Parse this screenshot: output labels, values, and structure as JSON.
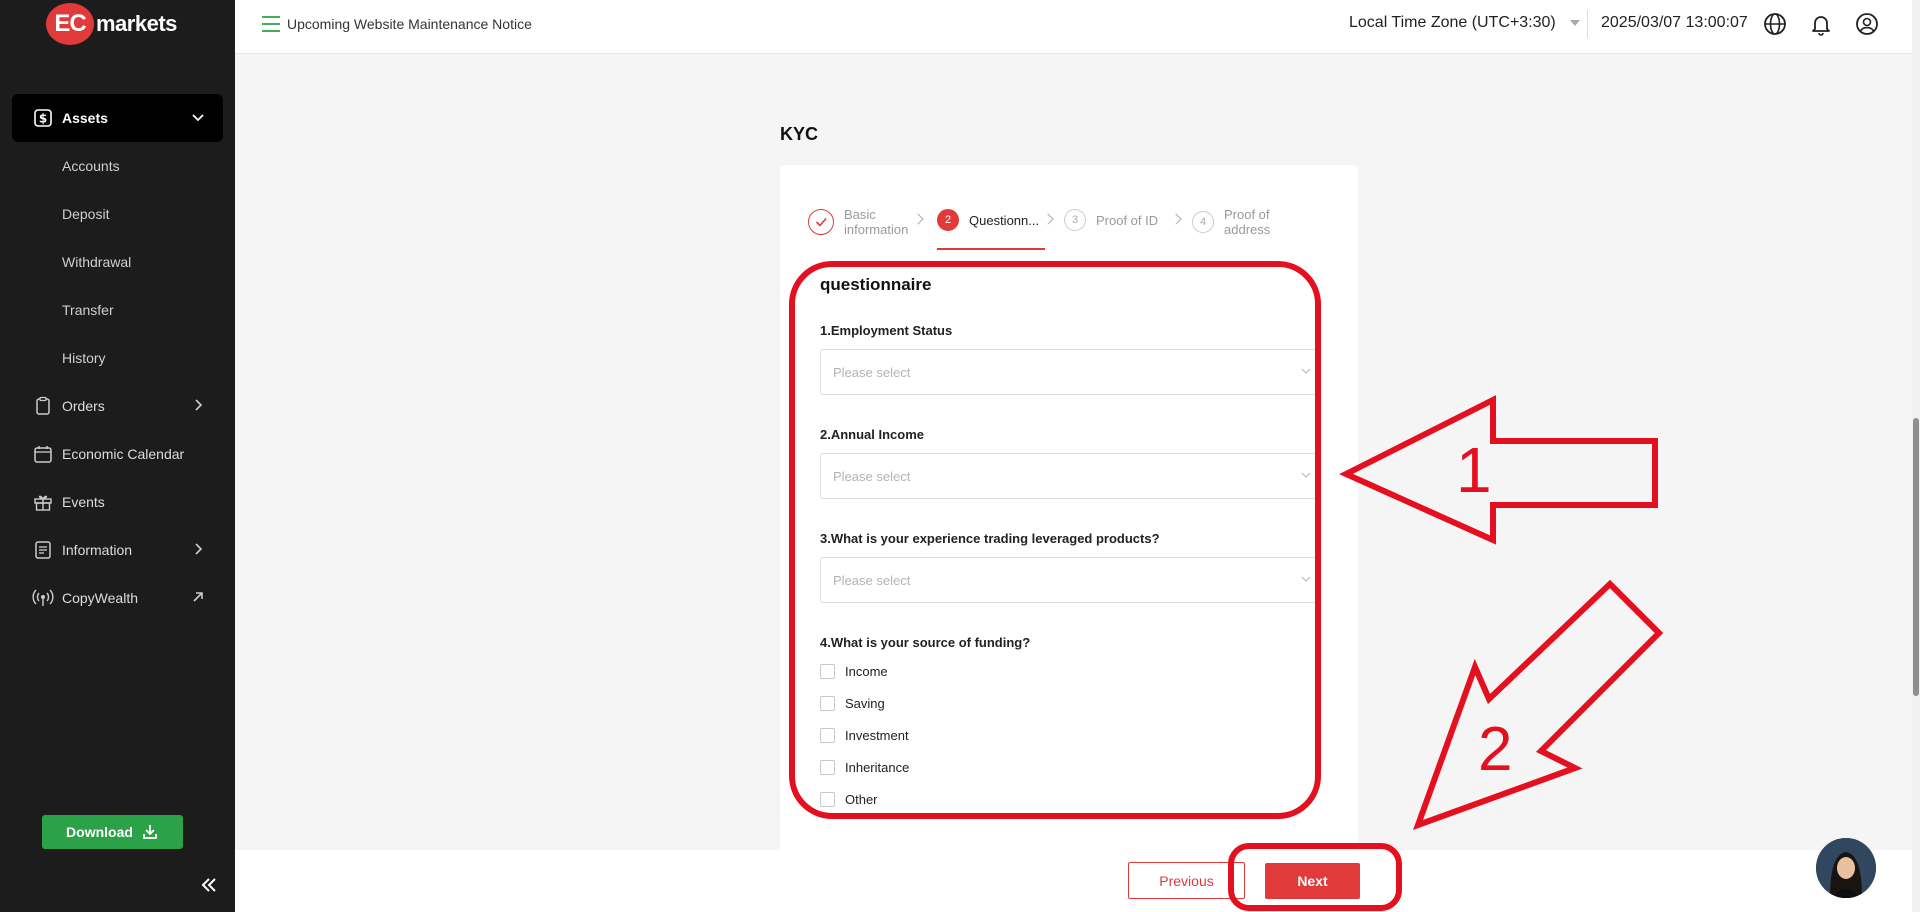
{
  "brand": {
    "badge": "EC",
    "name": "markets"
  },
  "sidebar": {
    "items": [
      {
        "label": "Assets",
        "icon": "dollar-square-icon"
      },
      {
        "label": "Accounts"
      },
      {
        "label": "Deposit"
      },
      {
        "label": "Withdrawal"
      },
      {
        "label": "Transfer"
      },
      {
        "label": "History"
      },
      {
        "label": "Orders",
        "icon": "clipboard-icon"
      },
      {
        "label": "Economic Calendar",
        "icon": "calendar-icon"
      },
      {
        "label": "Events",
        "icon": "gift-icon"
      },
      {
        "label": "Information",
        "icon": "document-icon"
      },
      {
        "label": "CopyWealth",
        "icon": "broadcast-icon"
      }
    ],
    "download_label": "Download"
  },
  "topbar": {
    "notice": "Upcoming Website Maintenance Notice",
    "timezone": "Local Time Zone (UTC+3:30)",
    "datetime": "2025/03/07 13:00:07"
  },
  "kyc": {
    "title": "KYC",
    "steps": [
      {
        "number": "",
        "label_line1": "Basic",
        "label_line2": "information",
        "state": "done"
      },
      {
        "number": "2",
        "label_line1": "Questionn...",
        "label_line2": "",
        "state": "current"
      },
      {
        "number": "3",
        "label_line1": "Proof of ID",
        "label_line2": "",
        "state": "pending"
      },
      {
        "number": "4",
        "label_line1": "Proof of",
        "label_line2": "address",
        "state": "pending"
      }
    ],
    "section_title": "questionnaire",
    "questions": [
      {
        "label": "1.Employment Status",
        "placeholder": "Please select"
      },
      {
        "label": "2.Annual Income",
        "placeholder": "Please select"
      },
      {
        "label": "3.What is your experience trading leveraged products?",
        "placeholder": "Please select"
      }
    ],
    "funding": {
      "label": "4.What is your source of funding?",
      "options": [
        "Income",
        "Saving",
        "Investment",
        "Inheritance",
        "Other"
      ]
    }
  },
  "footer": {
    "previous_label": "Previous",
    "next_label": "Next"
  },
  "annotations": {
    "arrow1_label": "1",
    "arrow2_label": "2"
  },
  "colors": {
    "accent": "#e03a3a",
    "download": "#2ba248",
    "sidebar_bg": "#1c1c1c",
    "annotation": "#e4101f"
  }
}
